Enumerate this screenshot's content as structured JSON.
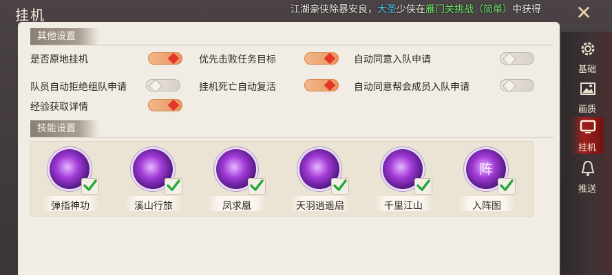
{
  "window": {
    "title": "挂机",
    "marquee": {
      "part1": "江湖豪侠除暴安良，",
      "part2": "大圣",
      "part3": "少侠在",
      "part4": "雁门关挑战（简单）",
      "part5": "中获得"
    }
  },
  "sections": {
    "other": "其他设置",
    "skills": "技能设置"
  },
  "options": [
    {
      "label": "是否原地挂机",
      "state": "on"
    },
    {
      "label": "优先击败任务目标",
      "state": "on"
    },
    {
      "label": "自动同意入队申请",
      "state": "off"
    },
    {
      "label": "队员自动拒绝组队申请",
      "state": "off"
    },
    {
      "label": "挂机死亡自动复活",
      "state": "on"
    },
    {
      "label": "自动同意帮会成员入队申请",
      "state": "off"
    },
    {
      "label": "经验获取详情",
      "state": "on"
    }
  ],
  "skills": [
    {
      "name": "弹指神功",
      "glyph": "",
      "checked": true
    },
    {
      "name": "溪山行旅",
      "glyph": "",
      "checked": true
    },
    {
      "name": "凤求凰",
      "glyph": "",
      "checked": true
    },
    {
      "name": "天羽逍遥扇",
      "glyph": "",
      "checked": true
    },
    {
      "name": "千里江山",
      "glyph": "",
      "checked": true
    },
    {
      "name": "入阵图",
      "glyph": "阵",
      "checked": true
    }
  ],
  "side_nav": [
    {
      "label": "基础",
      "icon": "gear-icon",
      "active": false
    },
    {
      "label": "画质",
      "icon": "image-icon",
      "active": false
    },
    {
      "label": "挂机",
      "icon": "monitor-icon",
      "active": true
    },
    {
      "label": "推送",
      "icon": "bell-icon",
      "active": false
    }
  ],
  "colors": {
    "toggle_on": "#e8925c",
    "toggle_knob_on": "#e2382a",
    "marquee_blue": "#4fd2ff",
    "marquee_green": "#6ee86e",
    "nav_active": "#aa1e19"
  }
}
